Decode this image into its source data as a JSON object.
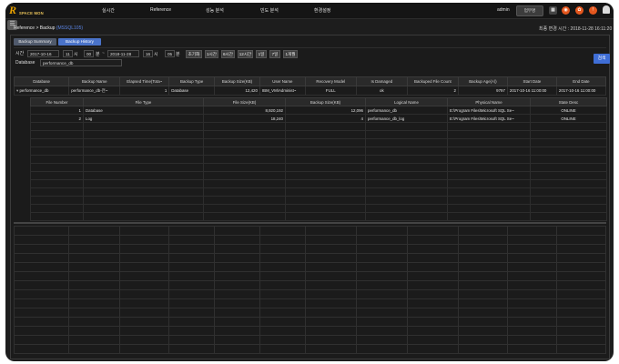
{
  "header": {
    "logo_text": "SPACE MON",
    "nav": [
      "실시간",
      "Reference",
      "성능 분석",
      "빈도 분석",
      "환경설정"
    ],
    "user": "admin",
    "logout_label": "업무명"
  },
  "breadcrumb": {
    "path": "Reference > Backup",
    "db": "(MSSQL105)"
  },
  "refresh_time": "최종 변경 시간 : 2018-11-28 16:11:20",
  "tabs": [
    "Backup Summary",
    "Backup History"
  ],
  "filter": {
    "time_label": "시간",
    "start_date": "2017-10-16",
    "start_hour": "11",
    "hour_unit": "시",
    "start_min": "00",
    "min_unit": "분",
    "end_date": "2018-11-28",
    "end_hour": "16",
    "end_min": "05",
    "quick": [
      "초기화",
      "1시간",
      "6시간",
      "12시간",
      "1일",
      "7일",
      "1개월"
    ],
    "db_label": "Database",
    "db_value": "performance_db",
    "search_label": "검색"
  },
  "main_table": {
    "headers": [
      "Database",
      "Backup Name",
      "Elapsed Time(Tota~",
      "Backup Type",
      "Backup Size(KB)",
      "User Name",
      "Recovery Model",
      "Is Damaged",
      "Backuped File Count",
      "Backup Age(시)",
      "Start Date",
      "End Date"
    ],
    "rows": [
      [
        "performance_db",
        "performance_db-전~",
        "1",
        "Database",
        "12,420",
        "IBM_VM\\Administ~",
        "FULL",
        "ok",
        "2",
        "9797",
        "2017-10-16 11:00:00",
        "2017-10-16 11:00:00"
      ]
    ]
  },
  "sub_table": {
    "headers": [
      "File Number",
      "File Type",
      "File Size(KB)",
      "Backup Size(KB)",
      "Logical Name",
      "Physical Name",
      "State Desc"
    ],
    "rows": [
      [
        "1",
        "Database",
        "8,920,192",
        "12,096",
        "performance_db",
        "E:\\Program Files\\Microsoft SQL Se~",
        "ONLINE"
      ],
      [
        "2",
        "Log",
        "18,240",
        "4",
        "performance_db_log",
        "E:\\Program Files\\Microsoft SQL Se~",
        "ONLINE"
      ]
    ]
  },
  "colors": {
    "accent": "#4a73c9",
    "logo": "#e8a100",
    "bg": "#1d1d1d"
  }
}
